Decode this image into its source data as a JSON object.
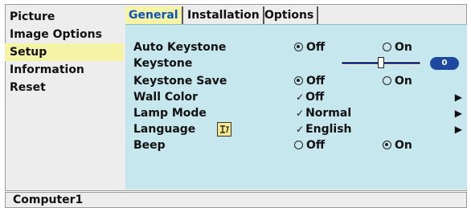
{
  "left_menu": {
    "items": [
      {
        "label": "Picture"
      },
      {
        "label": "Image Options"
      },
      {
        "label": "Setup"
      },
      {
        "label": "Information"
      },
      {
        "label": "Reset"
      }
    ],
    "selected": "Setup"
  },
  "tabs": [
    {
      "label": "General",
      "active": true
    },
    {
      "label": "Installation",
      "active": false
    },
    {
      "label": "Options",
      "active": false
    }
  ],
  "settings": {
    "auto_keystone": {
      "label": "Auto Keystone",
      "off": "Off",
      "on": "On",
      "value": "Off"
    },
    "keystone": {
      "label": "Keystone",
      "value": "0",
      "level": 0.5
    },
    "keystone_save": {
      "label": "Keystone Save",
      "off": "Off",
      "on": "On",
      "value": "Off"
    },
    "wall_color": {
      "label": "Wall Color",
      "value": "Off"
    },
    "lamp_mode": {
      "label": "Lamp Mode",
      "value": "Normal"
    },
    "language": {
      "label": "Language",
      "value": "English",
      "icon": "language-icon"
    },
    "beep": {
      "label": "Beep",
      "off": "Off",
      "on": "On",
      "value": "On"
    }
  },
  "status": {
    "source": "Computer1"
  },
  "colors": {
    "panel": "#c6e7ee",
    "highlight": "#f5f3a6",
    "active_tab_text": "#0c54b9",
    "badge": "#1d4aa0",
    "frame": "#ededed"
  }
}
